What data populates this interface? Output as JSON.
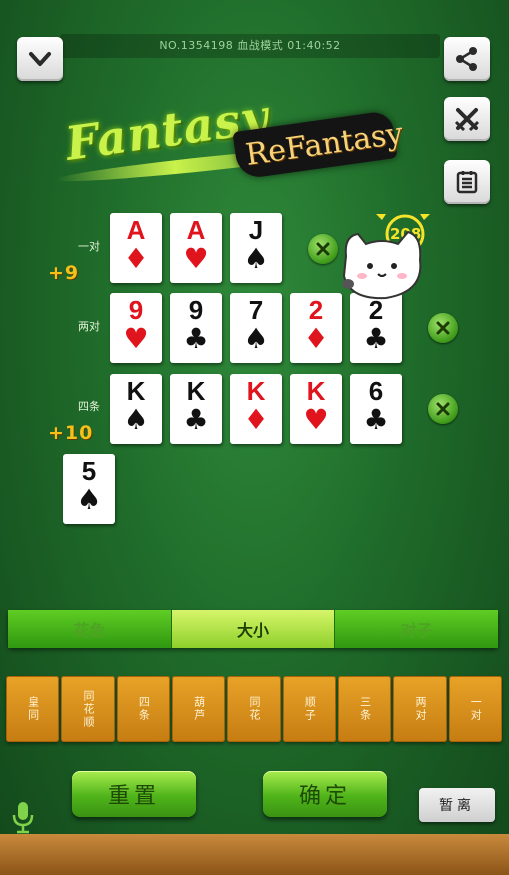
{
  "header": {
    "game_info": "NO.1354198  血战模式  01:40:52"
  },
  "logo": {
    "main": "Fantasy",
    "sub": "ReFantasy"
  },
  "score_badge": "208",
  "rows": [
    {
      "label": "一对",
      "bonus": "+9",
      "cards": [
        {
          "rank": "A",
          "suit": "♦",
          "color": "red"
        },
        {
          "rank": "A",
          "suit": "♥",
          "color": "red"
        },
        {
          "rank": "J",
          "suit": "♠",
          "color": "black"
        }
      ]
    },
    {
      "label": "两对",
      "bonus": "",
      "cards": [
        {
          "rank": "9",
          "suit": "♥",
          "color": "red"
        },
        {
          "rank": "9",
          "suit": "♣",
          "color": "black"
        },
        {
          "rank": "7",
          "suit": "♠",
          "color": "black"
        },
        {
          "rank": "2",
          "suit": "♦",
          "color": "red"
        },
        {
          "rank": "2",
          "suit": "♣",
          "color": "black"
        }
      ]
    },
    {
      "label": "四条",
      "bonus": "+10",
      "cards": [
        {
          "rank": "K",
          "suit": "♠",
          "color": "black"
        },
        {
          "rank": "K",
          "suit": "♣",
          "color": "black"
        },
        {
          "rank": "K",
          "suit": "♦",
          "color": "red"
        },
        {
          "rank": "K",
          "suit": "♥",
          "color": "red"
        },
        {
          "rank": "6",
          "suit": "♣",
          "color": "black"
        }
      ]
    }
  ],
  "extra_card": {
    "rank": "5",
    "suit": "♠",
    "color": "black"
  },
  "sort_tabs": [
    {
      "label": "花色",
      "active": false
    },
    {
      "label": "大小",
      "active": true
    },
    {
      "label": "对子",
      "active": false
    }
  ],
  "hand_types": [
    "皇同",
    "同花顺",
    "四条",
    "葫芦",
    "同花",
    "顺子",
    "三条",
    "两对",
    "一对"
  ],
  "buttons": {
    "reset": "重置",
    "confirm": "确定",
    "away": "暂离"
  },
  "colors": {
    "felt": "#1f6b2a",
    "red_suit": "#e0141c",
    "bonus": "#f3c11a",
    "hand_button": "#d98f1e"
  },
  "icons": {
    "collapse": "chevron-down-icon",
    "share": "share-icon",
    "swords": "crossed-swords-icon",
    "record": "scoreboard-icon",
    "remove": "close-icon",
    "mic": "microphone-icon"
  }
}
